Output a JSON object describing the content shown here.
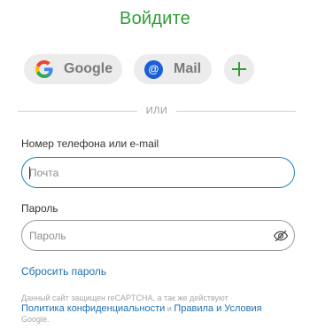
{
  "title": "Войдите",
  "social": {
    "google_label": "Google",
    "mail_label": "Mail"
  },
  "divider_text": "ИЛИ",
  "login": {
    "label": "Номер телефона или e-mail",
    "placeholder": "Почта",
    "value": ""
  },
  "password": {
    "label": "Пароль",
    "placeholder": "Пароль",
    "value": ""
  },
  "reset_link": "Сбросить пароль",
  "legal": {
    "prefix": "Данный сайт защищен reCAPTCHA, а так же действуют",
    "privacy_link": "Политика конфиденциальности",
    "and": "и",
    "terms_link": "Правила и Условия",
    "suffix": "Google."
  },
  "colors": {
    "brand_green": "#2f9e36",
    "link_blue": "#1d6fb0",
    "focus_border": "#1d83b8",
    "pill_bg": "#ececec",
    "mail_icon_bg": "#1b5fd6"
  },
  "icons": {
    "google": "google-g-icon",
    "mail": "at-sign-icon",
    "plus": "plus-icon",
    "eye": "eye-slash-icon"
  }
}
